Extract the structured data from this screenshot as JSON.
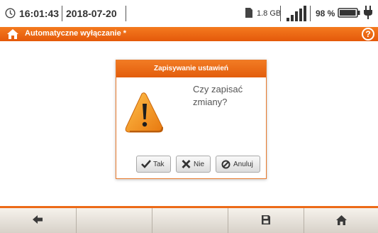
{
  "status_bar": {
    "time": "16:01:43",
    "date": "2018-07-20",
    "storage": "1.8 GB",
    "battery_percent": "98 %",
    "battery_level": 0.98,
    "icons": [
      "clock-icon",
      "sd-card-icon",
      "signal-icon",
      "battery-icon",
      "plug-icon"
    ]
  },
  "title_bar": {
    "title": "Automatyczne wyłączanie *",
    "help_glyph": "?"
  },
  "dialog": {
    "title": "Zapisywanie ustawień",
    "message_line1": "Czy zapisać",
    "message_line2": "zmiany?",
    "buttons": {
      "yes": "Tak",
      "no": "Nie",
      "cancel": "Anuluj"
    }
  },
  "toolbar": {
    "slots": [
      "back-arrow-icon",
      "",
      "",
      "",
      "save-icon",
      "home-icon"
    ]
  },
  "colors": {
    "accent": "#ee6a17",
    "title_text": "#ffffff",
    "warning_orange": "#f29a26"
  }
}
